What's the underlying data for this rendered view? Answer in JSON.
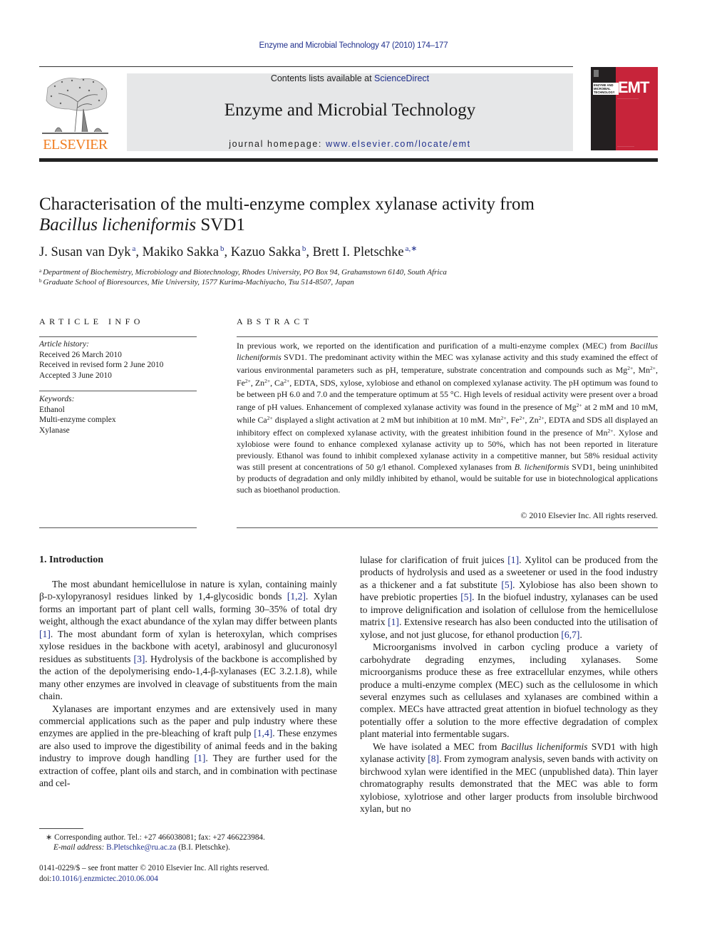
{
  "header": {
    "running_head": "Enzyme and Microbial Technology 47 (2010) 174–177",
    "contents_prefix": "Contents lists available at ",
    "contents_link": "ScienceDirect",
    "journal_name": "Enzyme and Microbial Technology",
    "homepage_prefix": "journal homepage: ",
    "homepage_link": "www.elsevier.com/locate/emt",
    "publisher_logo_text": "ELSEVIER",
    "cover": {
      "acronym": "EMT",
      "title_lines": [
        "ENZYME AND",
        "MICROBIAL",
        "TECHNOLOGY"
      ],
      "colors": {
        "dark": "#231f20",
        "red": "#c7243a"
      }
    },
    "colors": {
      "link": "#1f2f8c",
      "logo_orange": "#f07c1e",
      "banner_bg": "#e6e7e8"
    }
  },
  "article": {
    "title_line1": "Characterisation of the multi-enzyme complex xylanase activity from",
    "title_species": "Bacillus licheniformis",
    "title_strain": " SVD1",
    "authors": [
      {
        "name": "J. Susan van Dyk",
        "sup": "a"
      },
      {
        "name": "Makiko Sakka",
        "sup": "b"
      },
      {
        "name": "Kazuo Sakka",
        "sup": "b"
      },
      {
        "name": "Brett I. Pletschke",
        "sup": "a,∗"
      }
    ],
    "affiliations": [
      {
        "mark": "a",
        "text": "Department of Biochemistry, Microbiology and Biotechnology, Rhodes University, PO Box 94, Grahamstown 6140, South Africa"
      },
      {
        "mark": "b",
        "text": "Graduate School of Bioresources, Mie University, 1577 Kurima-Machiyacho, Tsu 514-8507, Japan"
      }
    ]
  },
  "article_info": {
    "heading": "ARTICLE INFO",
    "history_label": "Article history:",
    "history": [
      "Received 26 March 2010",
      "Received in revised form 2 June 2010",
      "Accepted 3 June 2010"
    ],
    "keywords_label": "Keywords:",
    "keywords": [
      "Ethanol",
      "Multi-enzyme complex",
      "Xylanase"
    ]
  },
  "abstract": {
    "heading": "ABSTRACT",
    "copyright": "© 2010 Elsevier Inc. All rights reserved."
  },
  "body": {
    "section_heading": "1.  Introduction"
  },
  "footnotes": {
    "corresponding": "∗  Corresponding author. Tel.: +27 466038081; fax: +27 466223984.",
    "email_label": "E-mail address: ",
    "email": "B.Pletschke@ru.ac.za",
    "email_suffix": " (B.I. Pletschke).",
    "front_matter": "0141-0229/$ – see front matter © 2010 Elsevier Inc. All rights reserved.",
    "doi_label": "doi:",
    "doi": "10.1016/j.enzmictec.2010.06.004"
  }
}
